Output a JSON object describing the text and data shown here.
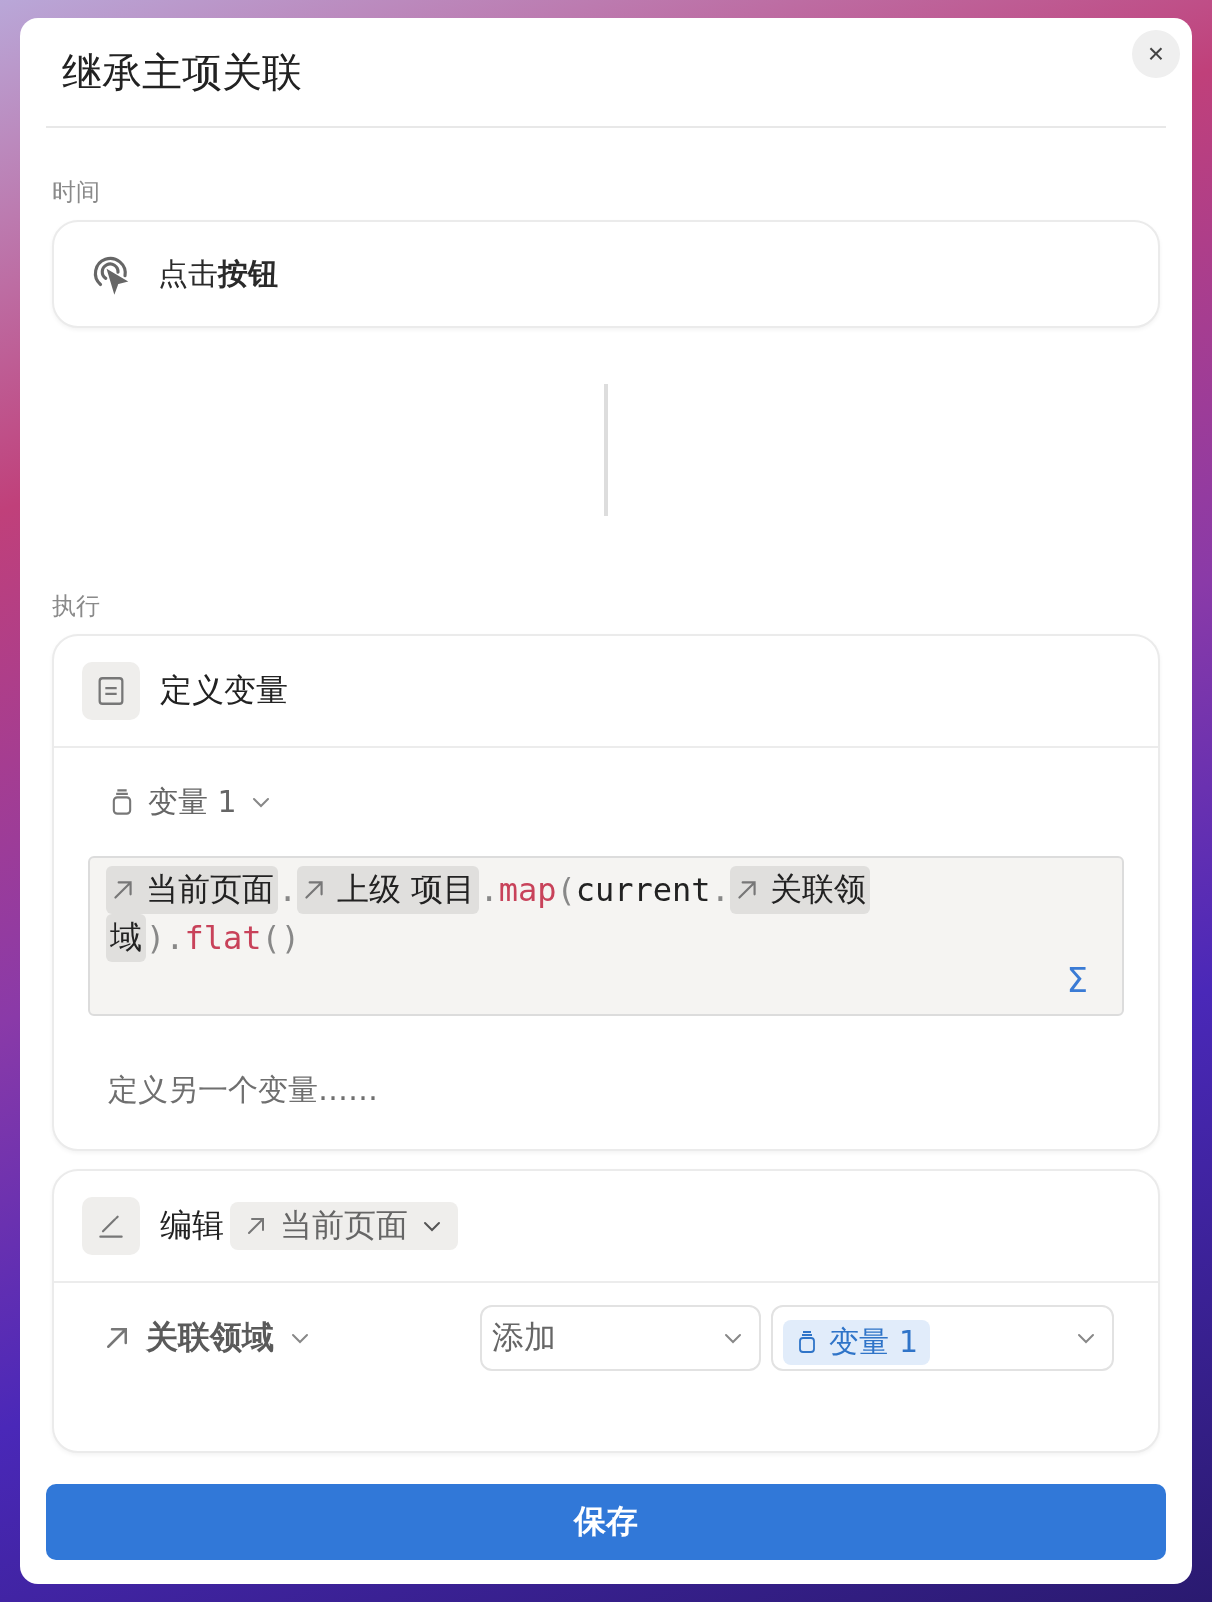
{
  "dialog": {
    "title": "继承主项关联",
    "close": "×"
  },
  "trigger": {
    "label": "时间",
    "prefix": "点击",
    "action": "按钮"
  },
  "execute": {
    "label": "执行",
    "define": {
      "title": "定义变量",
      "variable": "变量 1",
      "formula_lines": [
        [
          {
            "kind": "chip",
            "arrow": true,
            "text": "当前页面"
          },
          {
            "kind": "punct",
            "text": "."
          },
          {
            "kind": "chip",
            "arrow": true,
            "text": "上级 项目"
          },
          {
            "kind": "punct",
            "text": "."
          },
          {
            "kind": "func",
            "text": "map"
          },
          {
            "kind": "punct",
            "text": "("
          },
          {
            "kind": "plain",
            "text": "current"
          },
          {
            "kind": "punct",
            "text": "."
          },
          {
            "kind": "chip",
            "arrow": true,
            "text": "关联领"
          }
        ],
        [
          {
            "kind": "chip",
            "arrow": false,
            "text": "域"
          },
          {
            "kind": "punct",
            "text": ")."
          },
          {
            "kind": "func",
            "text": "flat"
          },
          {
            "kind": "punct",
            "text": "()"
          }
        ]
      ],
      "sigma": "Σ",
      "add_variable": "定义另一个变量……"
    },
    "edit": {
      "title": "编辑",
      "target": "当前页面",
      "property": "关联领域",
      "operation": "添加",
      "value": "变量 1"
    }
  },
  "save": "保存"
}
